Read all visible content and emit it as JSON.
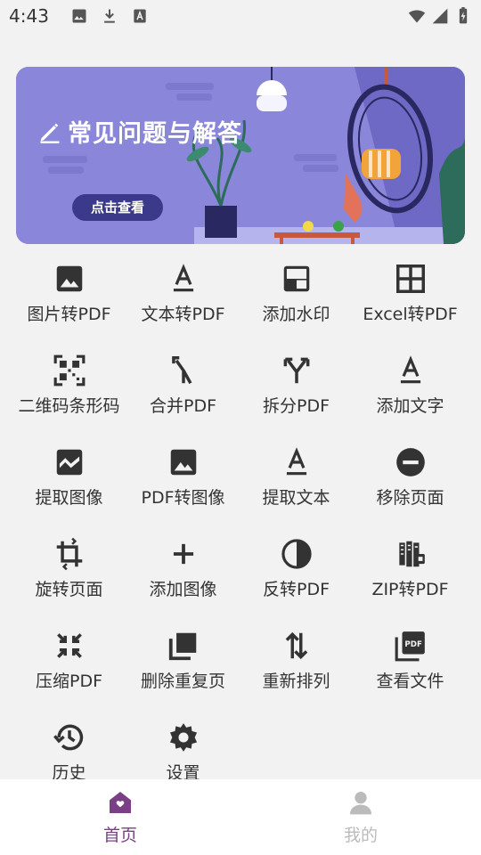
{
  "status_bar": {
    "time": "4:43",
    "left_icons": [
      "image-icon",
      "download-icon",
      "font-a-icon"
    ],
    "right_icons": [
      "wifi-icon",
      "signal-icon",
      "battery-icon"
    ]
  },
  "banner": {
    "title": "常见问题与解答",
    "button_label": "点击查看",
    "background_color": "#8a86da",
    "button_color": "#3b3a8a"
  },
  "tools": [
    {
      "label": "图片转PDF",
      "icon": "image-icon"
    },
    {
      "label": "文本转PDF",
      "icon": "text-format-icon"
    },
    {
      "label": "添加水印",
      "icon": "watermark-icon"
    },
    {
      "label": "Excel转PDF",
      "icon": "grid-icon"
    },
    {
      "label": "二维码条形码",
      "icon": "qr-code-icon"
    },
    {
      "label": "合并PDF",
      "icon": "merge-icon"
    },
    {
      "label": "拆分PDF",
      "icon": "split-icon"
    },
    {
      "label": "添加文字",
      "icon": "text-format-icon"
    },
    {
      "label": "提取图像",
      "icon": "wave-image-icon"
    },
    {
      "label": "PDF转图像",
      "icon": "image-icon"
    },
    {
      "label": "提取文本",
      "icon": "text-format-icon"
    },
    {
      "label": "移除页面",
      "icon": "remove-circle-icon"
    },
    {
      "label": "旋转页面",
      "icon": "rotate-icon"
    },
    {
      "label": "添加图像",
      "icon": "add-icon"
    },
    {
      "label": "反转PDF",
      "icon": "invert-icon"
    },
    {
      "label": "ZIP转PDF",
      "icon": "zip-icon"
    },
    {
      "label": "压缩PDF",
      "icon": "compress-icon"
    },
    {
      "label": "删除重复页",
      "icon": "duplicate-icon"
    },
    {
      "label": "重新排列",
      "icon": "reorder-icon"
    },
    {
      "label": "查看文件",
      "icon": "pdf-file-icon"
    },
    {
      "label": "历史",
      "icon": "history-icon"
    },
    {
      "label": "设置",
      "icon": "gear-icon"
    }
  ],
  "bottom_nav": {
    "home_label": "首页",
    "mine_label": "我的",
    "active_color": "#7b3f86",
    "inactive_color": "#bbbbbb"
  }
}
